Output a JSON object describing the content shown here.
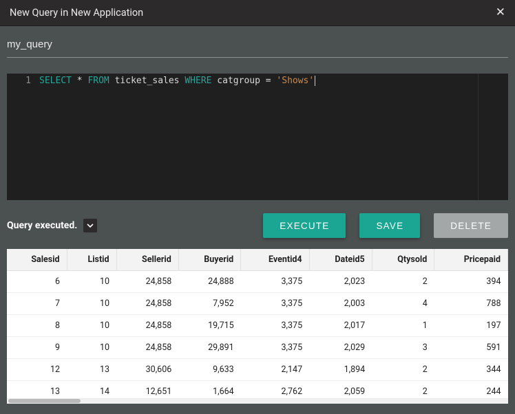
{
  "window": {
    "title": "New Query in New Application"
  },
  "query_name": "my_query",
  "editor": {
    "line_number": "1",
    "tokens": {
      "select": "SELECT",
      "star": " * ",
      "from": "FROM",
      "table": " ticket_sales ",
      "where": "WHERE",
      "col": " catgroup ",
      "eq": "= ",
      "val": "'Shows'"
    }
  },
  "status": "Query executed.",
  "buttons": {
    "execute": "EXECUTE",
    "save": "SAVE",
    "delete": "DELETE"
  },
  "table": {
    "headers": [
      "Salesid",
      "Listid",
      "Sellerid",
      "Buyerid",
      "Eventid4",
      "Dateid5",
      "Qtysold",
      "Pricepaid"
    ],
    "rows": [
      [
        "6",
        "10",
        "24,858",
        "24,888",
        "3,375",
        "2,023",
        "2",
        "394"
      ],
      [
        "7",
        "10",
        "24,858",
        "7,952",
        "3,375",
        "2,003",
        "4",
        "788"
      ],
      [
        "8",
        "10",
        "24,858",
        "19,715",
        "3,375",
        "2,017",
        "1",
        "197"
      ],
      [
        "9",
        "10",
        "24,858",
        "29,891",
        "3,375",
        "2,029",
        "3",
        "591"
      ],
      [
        "12",
        "13",
        "30,606",
        "9,633",
        "2,147",
        "1,894",
        "2",
        "344"
      ],
      [
        "13",
        "14",
        "12,651",
        "1,664",
        "2,762",
        "2,059",
        "2",
        "244"
      ]
    ]
  }
}
